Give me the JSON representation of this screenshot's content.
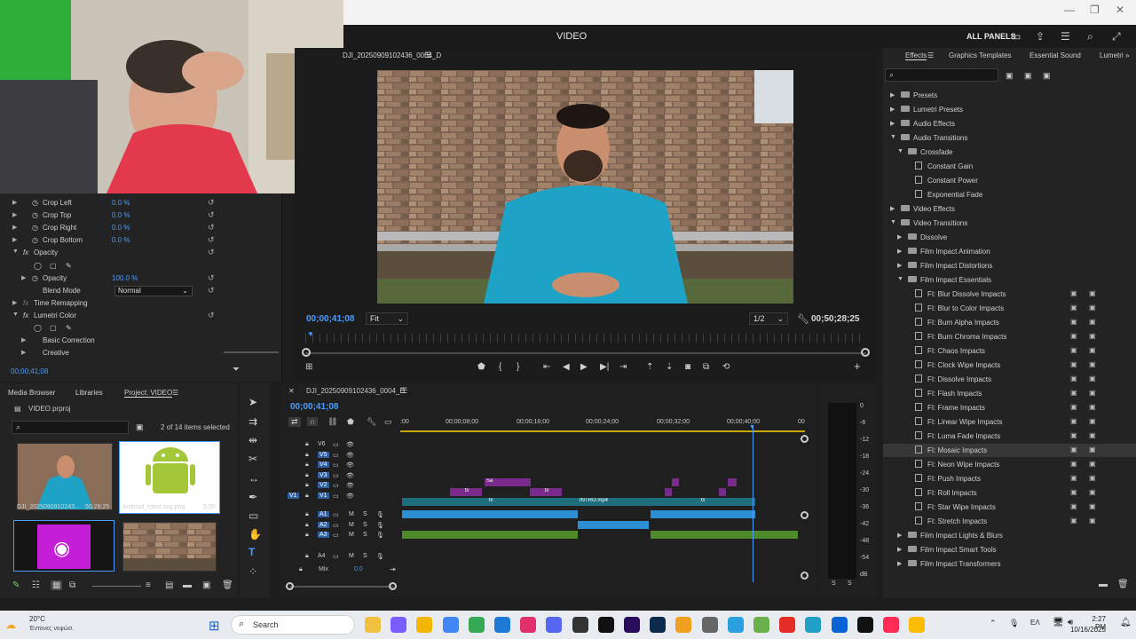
{
  "window": {
    "title": "VIDEO",
    "all_panels": "ALL PANELS",
    "min": "—",
    "max": "❐",
    "close": "✕"
  },
  "effect_controls": {
    "rows": [
      {
        "label": "Crop Left",
        "value": "0.0 %"
      },
      {
        "label": "Crop Top",
        "value": "0.0 %"
      },
      {
        "label": "Crop Right",
        "value": "0.0 %"
      },
      {
        "label": "Crop Bottom",
        "value": "0.0 %"
      }
    ],
    "opacity_section": "Opacity",
    "opacity_label": "Opacity",
    "opacity_value": "100.0 %",
    "blend_mode_label": "Blend Mode",
    "blend_mode_value": "Normal",
    "time_remapping": "Time Remapping",
    "lumetri_color": "Lumetri Color",
    "basic_correction": "Basic Correction",
    "creative": "Creative",
    "timecode": "00;00;41;08",
    "fx_glyph": "fx"
  },
  "program_monitor": {
    "sequence_name": "DJI_20250909102436_0004_D",
    "timecode": "00;00;41;08",
    "fit": "Fit",
    "resolution": "1/2",
    "duration": "00;50;28;25"
  },
  "effects_panel": {
    "tabs": [
      "Effects",
      "Graphics Templates",
      "Essential Sound",
      "Lumetri"
    ],
    "items": [
      {
        "label": "Presets",
        "indent": 0,
        "kind": "folder",
        "open": false
      },
      {
        "label": "Lumetri Presets",
        "indent": 0,
        "kind": "folder",
        "open": false
      },
      {
        "label": "Audio Effects",
        "indent": 0,
        "kind": "folder",
        "open": false
      },
      {
        "label": "Audio Transitions",
        "indent": 0,
        "kind": "folder",
        "open": true
      },
      {
        "label": "Crossfade",
        "indent": 1,
        "kind": "folder",
        "open": true
      },
      {
        "label": "Constant Gain",
        "indent": 2,
        "kind": "fx"
      },
      {
        "label": "Constant Power",
        "indent": 2,
        "kind": "fx"
      },
      {
        "label": "Exponential Fade",
        "indent": 2,
        "kind": "fx"
      },
      {
        "label": "Video Effects",
        "indent": 0,
        "kind": "folder",
        "open": false
      },
      {
        "label": "Video Transitions",
        "indent": 0,
        "kind": "folder",
        "open": true
      },
      {
        "label": "Dissolve",
        "indent": 1,
        "kind": "folder",
        "open": false
      },
      {
        "label": "Film Impact Animation",
        "indent": 1,
        "kind": "folder",
        "open": false
      },
      {
        "label": "Film Impact Distortions",
        "indent": 1,
        "kind": "folder",
        "open": false
      },
      {
        "label": "Film Impact Essentials",
        "indent": 1,
        "kind": "folder",
        "open": true
      },
      {
        "label": "FI: Blur Dissolve Impacts",
        "indent": 2,
        "kind": "fx",
        "badges": true
      },
      {
        "label": "FI: Blur to Color Impacts",
        "indent": 2,
        "kind": "fx",
        "badges": true
      },
      {
        "label": "FI: Burn Alpha Impacts",
        "indent": 2,
        "kind": "fx",
        "badges": true
      },
      {
        "label": "FI: Burn Chroma Impacts",
        "indent": 2,
        "kind": "fx",
        "badges": true
      },
      {
        "label": "FI: Chaos Impacts",
        "indent": 2,
        "kind": "fx",
        "badges": true
      },
      {
        "label": "FI: Clock Wipe Impacts",
        "indent": 2,
        "kind": "fx",
        "badges": true
      },
      {
        "label": "FI: Dissolve Impacts",
        "indent": 2,
        "kind": "fx",
        "badges": true
      },
      {
        "label": "FI: Flash Impacts",
        "indent": 2,
        "kind": "fx",
        "badges": true
      },
      {
        "label": "FI: Frame Impacts",
        "indent": 2,
        "kind": "fx",
        "badges": true
      },
      {
        "label": "FI: Linear Wipe Impacts",
        "indent": 2,
        "kind": "fx",
        "badges": true
      },
      {
        "label": "FI: Luma Fade Impacts",
        "indent": 2,
        "kind": "fx",
        "badges": true
      },
      {
        "label": "FI: Mosaic Impacts",
        "indent": 2,
        "kind": "fx",
        "badges": true,
        "highlight": true
      },
      {
        "label": "FI: Neon Wipe Impacts",
        "indent": 2,
        "kind": "fx",
        "badges": true
      },
      {
        "label": "FI: Push Impacts",
        "indent": 2,
        "kind": "fx",
        "badges": true
      },
      {
        "label": "FI: Roll Impacts",
        "indent": 2,
        "kind": "fx",
        "badges": true
      },
      {
        "label": "FI: Star Wipe Impacts",
        "indent": 2,
        "kind": "fx",
        "badges": true
      },
      {
        "label": "FI: Stretch Impacts",
        "indent": 2,
        "kind": "fx",
        "badges": true
      },
      {
        "label": "Film Impact Lights & Blurs",
        "indent": 1,
        "kind": "folder",
        "open": false
      },
      {
        "label": "Film Impact Smart Tools",
        "indent": 1,
        "kind": "folder",
        "open": false
      },
      {
        "label": "Film Impact Transformers",
        "indent": 1,
        "kind": "folder",
        "open": false
      }
    ]
  },
  "project_panel": {
    "tabs": [
      "Media Browser",
      "Libraries",
      "Project: VIDEO"
    ],
    "file": "VIDEO.prproj",
    "selection": "2 of 14 items selected",
    "items": [
      {
        "name": "DJI_202509091024З...",
        "duration": "50;28;25"
      },
      {
        "name": "Android_robot.svg.png",
        "duration": "5;00"
      }
    ]
  },
  "timeline": {
    "sequence_name": "DJI_20250909102436_0004_D",
    "timecode": "00;00;41;08",
    "ruler": [
      ":00",
      "00;00;08;00",
      "00;00;16;00",
      "00;00;24;00",
      "00;00;32;00",
      "00;00;40;00",
      "00"
    ],
    "video_tracks": [
      "V6",
      "V5",
      "V4",
      "V3",
      "V2",
      "V1"
    ],
    "audio_tracks": [
      "A1",
      "A2",
      "A3",
      "A4"
    ],
    "mix_label": "Mix",
    "mix_value": "0.0",
    "clips": {
      "v3_label": "Sa",
      "v1_label": "INTRO.mp4"
    },
    "m": "M",
    "s": "S"
  },
  "meter": {
    "scale": [
      "0",
      "-6",
      "-12",
      "-18",
      "-24",
      "-30",
      "-36",
      "-42",
      "-48",
      "-54",
      "dB"
    ],
    "s": "S"
  },
  "taskbar": {
    "temp": "20°C",
    "weather": "Έντονες νεφώσ.",
    "search": "Search",
    "lang": "ΕΛ",
    "time": "2:27 PM",
    "date": "10/16/2025"
  },
  "colors": {
    "accent": "#4a9dff",
    "clip_teal": "#1f6e7e",
    "clip_purple": "#7a2a8a",
    "audio_blue": "#2c8fd4",
    "audio_green": "#4d8a2a"
  }
}
